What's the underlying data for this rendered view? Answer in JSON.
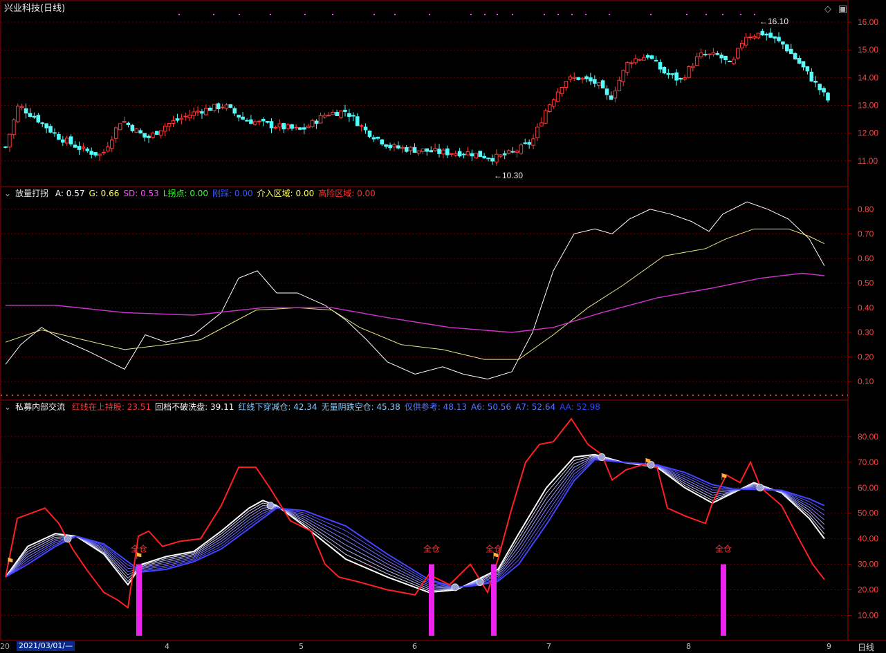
{
  "panel1": {
    "title": "兴业科技(日线)",
    "high_label": "16.10",
    "low_label": "10.30",
    "yticks": [
      "16.00",
      "15.00",
      "14.00",
      "13.00",
      "12.00",
      "11.00"
    ],
    "colors": {
      "up": "#ff3b3b",
      "down": "#54fcfc",
      "grid": "#7a0000"
    }
  },
  "panel2": {
    "name": "放量打拐",
    "items": [
      {
        "label": "A:",
        "value": "0.57",
        "color": "#ffffff"
      },
      {
        "label": "G:",
        "value": "0.66",
        "color": "#ffff66"
      },
      {
        "label": "SD:",
        "value": "0.53",
        "color": "#ff44ff"
      },
      {
        "label": "L拐点:",
        "value": "0.00",
        "color": "#33ff33"
      },
      {
        "label": "刚踩:",
        "value": "0.00",
        "color": "#3355ff"
      },
      {
        "label": "介入区域:",
        "value": "0.00",
        "color": "#ffff66"
      },
      {
        "label": "高险区域:",
        "value": "0.00",
        "color": "#ff3333"
      }
    ],
    "yticks": [
      "0.80",
      "0.70",
      "0.60",
      "0.50",
      "0.40",
      "0.30",
      "0.20",
      "0.10"
    ]
  },
  "panel3": {
    "name": "私募内部交流",
    "items": [
      {
        "label": "红线在上持股:",
        "value": "23.51",
        "color": "#ff3333"
      },
      {
        "label": "回档不破洗盘:",
        "value": "39.11",
        "color": "#ffffff"
      },
      {
        "label": "红线下穿减仓:",
        "value": "42.34",
        "color": "#88ccff"
      },
      {
        "label": "无量阴跌空仓:",
        "value": "45.38",
        "color": "#88ccff"
      },
      {
        "label": "仅供参考:",
        "value": "48.13",
        "color": "#5577ff"
      },
      {
        "label": "A6:",
        "value": "50.56",
        "color": "#5577ff"
      },
      {
        "label": "A7:",
        "value": "52.64",
        "color": "#5577ff"
      },
      {
        "label": "AA:",
        "value": "52.98",
        "color": "#3344ff"
      }
    ],
    "yticks": [
      "80.00",
      "70.00",
      "60.00",
      "50.00",
      "40.00",
      "30.00",
      "20.00",
      "10.00"
    ],
    "signal_label": "全仓"
  },
  "xaxis": {
    "start_prefix": "20",
    "date_box": "2021/03/01/—",
    "months": [
      "4",
      "5",
      "6",
      "7",
      "8",
      "9"
    ],
    "period": "日线"
  },
  "icons": {
    "diamond": "diamond-icon",
    "settings": "settings-icon",
    "toggle": "chevron-down-icon"
  }
}
